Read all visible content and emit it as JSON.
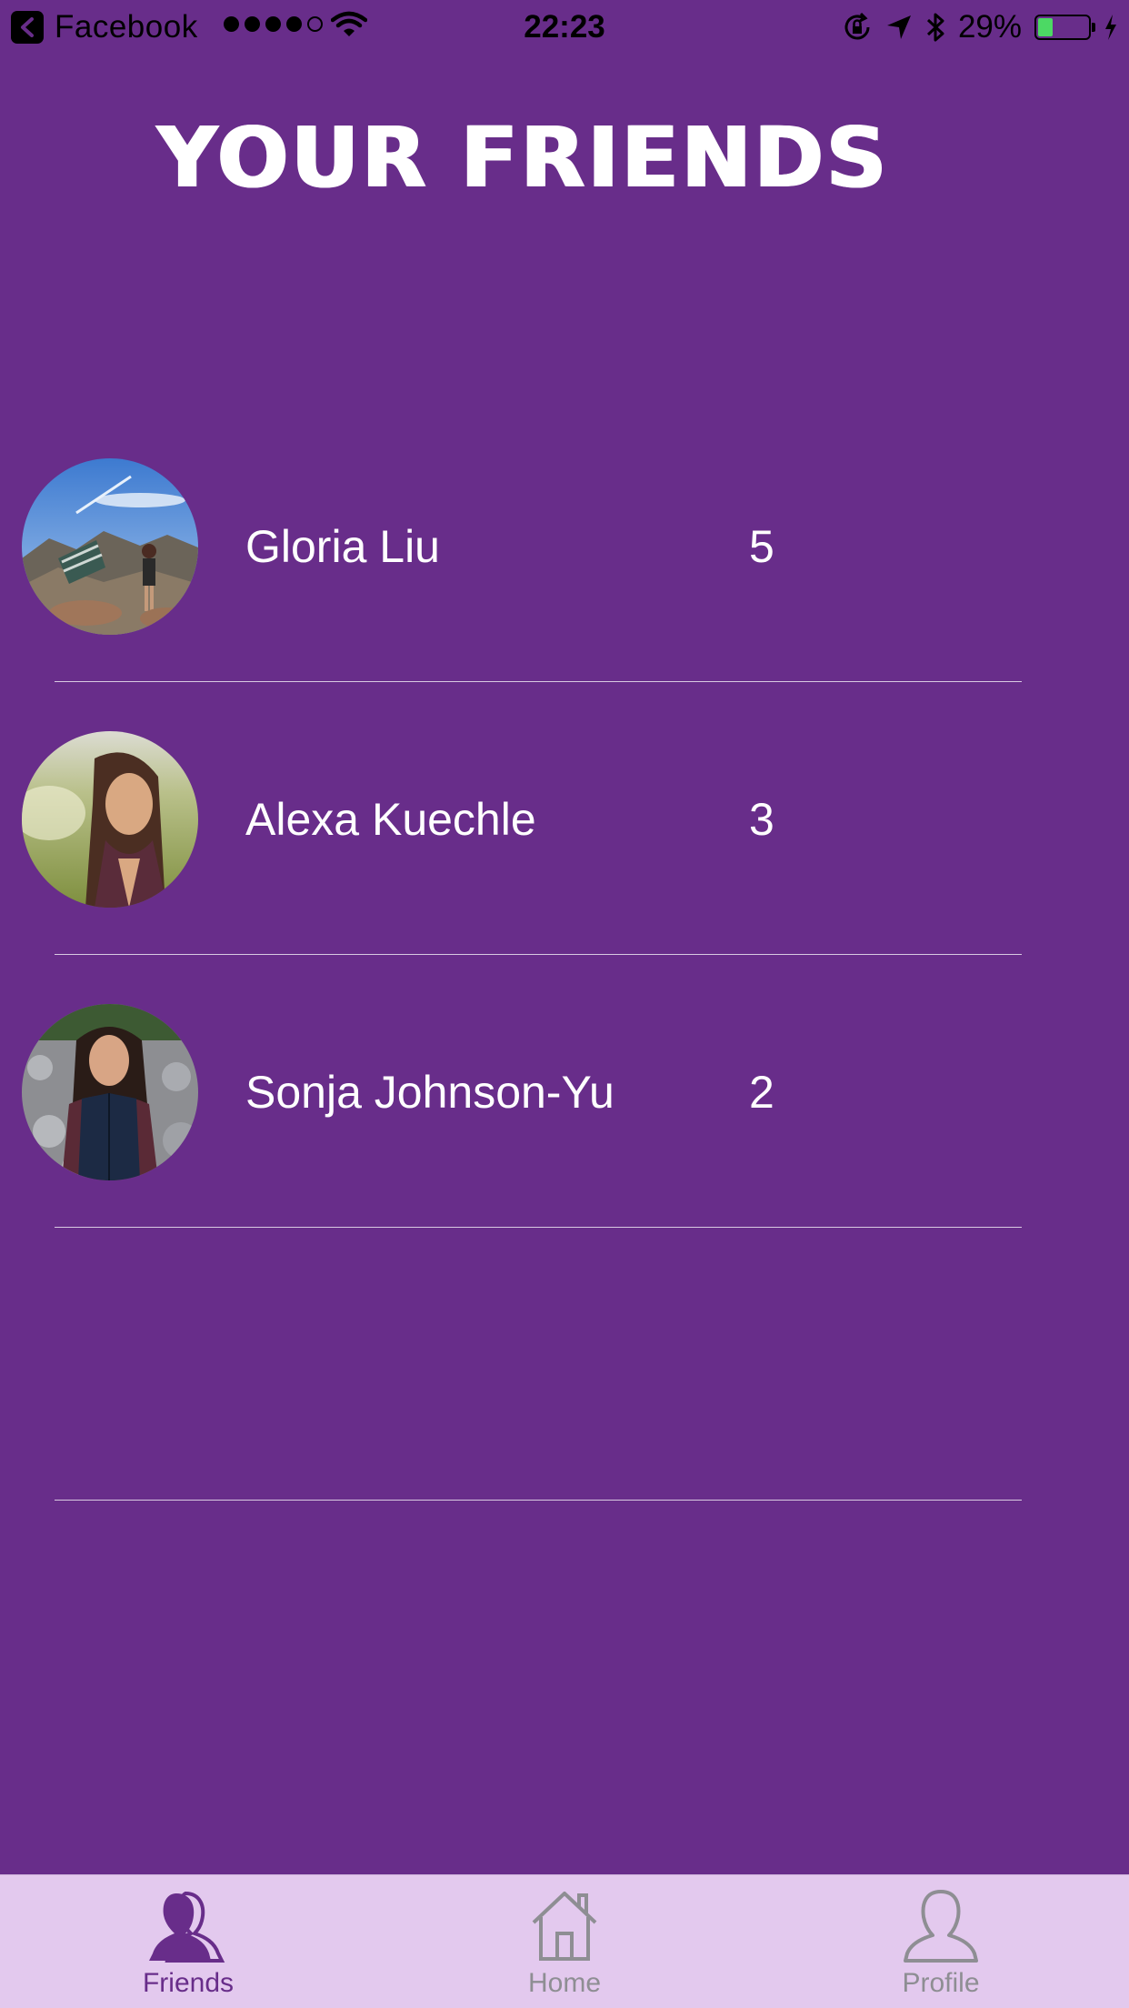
{
  "status_bar": {
    "back_app": "Facebook",
    "time": "22:23",
    "battery_percent": "29%",
    "battery_level": 0.29,
    "signal_strength": 4,
    "signal_max": 5
  },
  "header": {
    "title": "YOUR FRIENDS"
  },
  "friends": [
    {
      "name": "Gloria Liu",
      "score": "5"
    },
    {
      "name": "Alexa Kuechle",
      "score": "3"
    },
    {
      "name": "Sonja Johnson-Yu",
      "score": "2"
    },
    {
      "name": "",
      "score": ""
    }
  ],
  "tabs": [
    {
      "label": "Friends",
      "icon": "friends-icon",
      "active": true
    },
    {
      "label": "Home",
      "icon": "home-icon",
      "active": false
    },
    {
      "label": "Profile",
      "icon": "profile-icon",
      "active": false
    }
  ],
  "colors": {
    "background": "#682d8a",
    "tab_bar": "#e3c9ee",
    "active_tab": "#682d8a",
    "inactive_tab": "#8e8e93",
    "battery": "#4cd964"
  }
}
